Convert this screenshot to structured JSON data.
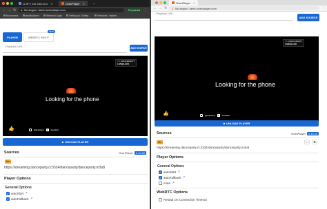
{
  "left_window": {
    "tabs": [
      {
        "label": "LLSP | 192.168.20.2",
        "active": false
      },
      {
        "label": "OvenPlayer",
        "active": true
      }
    ],
    "address": {
      "warning": "No seguro",
      "url": "demo.ovenplayer.com"
    },
    "profile_label": "En pausa",
    "bookmarks": [
      "Bookmarks",
      "phpMyAdmin",
      "Webmail Login",
      "Setting up Chilliep...",
      "Networks: Implem..."
    ],
    "page": {
      "tab_player": "PLAYER",
      "tab_webrtc": "WEBRTC INPUT",
      "tab_webrtc_badge": "NEW",
      "playback_url_label": "Playback URL",
      "add_source_label": "ADD SOURCE",
      "video": {
        "caption": "Looking for the phone",
        "channel_hd": "HD",
        "channel_name": "DANCEPARTY",
        "channel_live": "LIVEBLACK",
        "social_handle": "@liveblack",
        "social_page": "liveblack"
      },
      "unload_label": "UNLOAD PLAYER",
      "sources_title": "Sources",
      "player_name": "OvenPlayer",
      "player_version": "0.10.22",
      "source_badge": "hls",
      "source_url": "https://streaming.danceparty.cl:3334/danceparty/danceparty.m3u8",
      "player_options_title": "Player Options",
      "general_options_title": "General Options",
      "options": [
        {
          "label": "autoStart",
          "checked": true
        },
        {
          "label": "autoFallback",
          "checked": true
        }
      ]
    }
  },
  "right_window": {
    "tabs": [
      {
        "label": "OvenPlayer",
        "active": true
      }
    ],
    "address": {
      "warning": "No seguro",
      "url": "demo.ovenplayer.com"
    },
    "page": {
      "playback_url_label": "Playback URL",
      "add_source_label": "ADD SOURCE",
      "video": {
        "caption": "Looking for the phone",
        "channel_hd": "HD",
        "channel_name": "DANCEPARTY",
        "channel_live": "LIVEBLACK",
        "social_handle": "@liveblack",
        "social_page": "liveblack"
      },
      "unload_label": "UNLOAD PLAYER",
      "sources_title": "Sources",
      "player_name": "OvenPlayer",
      "player_version": "0.10.22",
      "source_badge": "hls",
      "source_url": "https://streaming.danceparty.cl:3334/danceparty/danceparty.m3u8",
      "player_options_title": "Player Options",
      "general_options_title": "General Options",
      "options": [
        {
          "label": "autoStart",
          "checked": true
        },
        {
          "label": "autoFallback",
          "checked": true
        },
        {
          "label": "mute",
          "checked": false
        }
      ],
      "webrtc_options_title": "WebRTC Options",
      "webrtc_options": [
        {
          "label": "Reload On Connection Timeout",
          "checked": false
        }
      ]
    }
  },
  "colors": {
    "primary": "#1967d2",
    "hls_badge": "#f6a43a",
    "browser_dark": "#1f1f1f"
  },
  "icons": [
    "back-icon",
    "forward-icon",
    "reload-icon",
    "warning-icon",
    "play-icon",
    "link-icon",
    "copy-icon",
    "external-link-icon",
    "thumbs-up-icon",
    "close-icon"
  ]
}
